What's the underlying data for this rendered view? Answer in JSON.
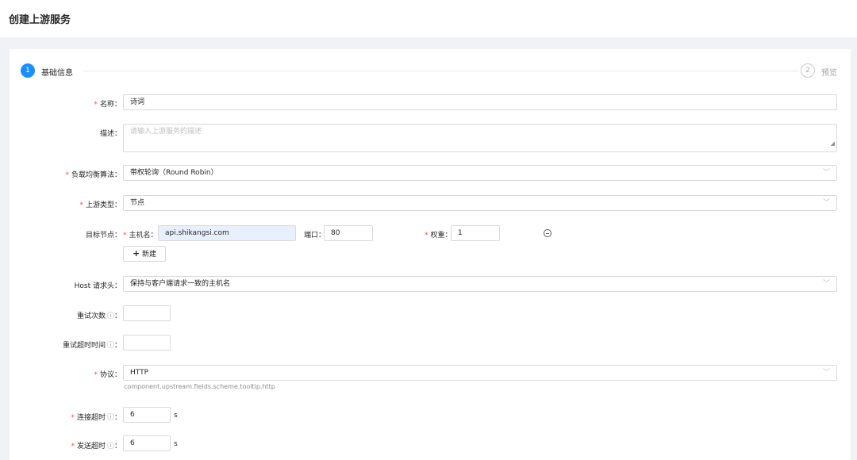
{
  "page": {
    "title": "创建上游服务"
  },
  "steps": [
    {
      "number": "1",
      "label": "基础信息"
    },
    {
      "number": "2",
      "label": "预览"
    }
  ],
  "form": {
    "name": {
      "label": "名称",
      "value": "诗词"
    },
    "description": {
      "label": "描述",
      "placeholder": "请输入上游服务的描述"
    },
    "load_balance": {
      "label": "负载均衡算法",
      "value": "带权轮询（Round Robin）"
    },
    "upstream_type": {
      "label": "上游类型",
      "value": "节点"
    },
    "target_nodes": {
      "label": "目标节点",
      "host_label": "主机名",
      "host_value": "api.shikangsi.com",
      "port_label": "端口",
      "port_value": "80",
      "weight_label": "权重",
      "weight_value": "1",
      "add_label": "新建"
    },
    "host_header": {
      "label": "Host 请求头",
      "value": "保持与客户端请求一致的主机名"
    },
    "retries": {
      "label": "重试次数",
      "value": ""
    },
    "retry_timeout": {
      "label": "重试超时时间",
      "value": ""
    },
    "scheme": {
      "label": "协议",
      "value": "HTTP",
      "hint": "component.upstream.fields.scheme.tooltip.http"
    },
    "connect_timeout": {
      "label": "连接超时",
      "value": "6",
      "unit": "s"
    },
    "send_timeout": {
      "label": "发送超时",
      "value": "6",
      "unit": "s"
    }
  },
  "icons": {
    "help": "question-circle-icon",
    "dropdown": "chevron-down-icon",
    "add": "plus-icon",
    "remove": "minus-circle-icon"
  },
  "colors": {
    "accent": "#1890ff",
    "required": "#ff4d4f",
    "autofill": "#e8f0fe"
  }
}
